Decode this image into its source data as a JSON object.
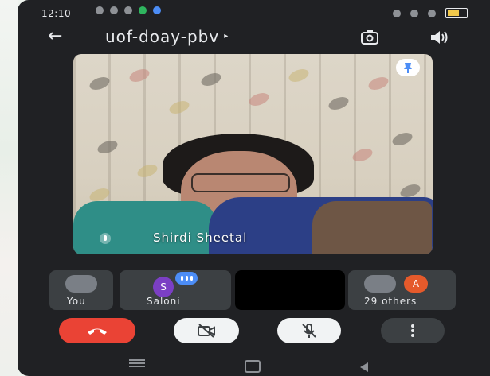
{
  "status_bar": {
    "time": "12:10"
  },
  "top_bar": {
    "meeting_code": "uof-doay-pbv",
    "chevron": "▸"
  },
  "video": {
    "speaker_name": "Shirdi Sheetal"
  },
  "participants": {
    "you_label": "You",
    "saloni_label": "Saloni",
    "saloni_initial": "S",
    "others_label": "29 others",
    "others_initial": "A"
  },
  "controls": {
    "end_call_icon": "phone-hangup-icon",
    "camera_icon": "camera-off-icon",
    "mic_icon": "mic-off-icon",
    "more_icon": "more-options-icon"
  },
  "colors": {
    "end_call": "#ea4335",
    "avatar_s": "#7b3fc4",
    "avatar_a": "#e55a2b",
    "speaking": "#4c8df6",
    "background": "#202124"
  }
}
